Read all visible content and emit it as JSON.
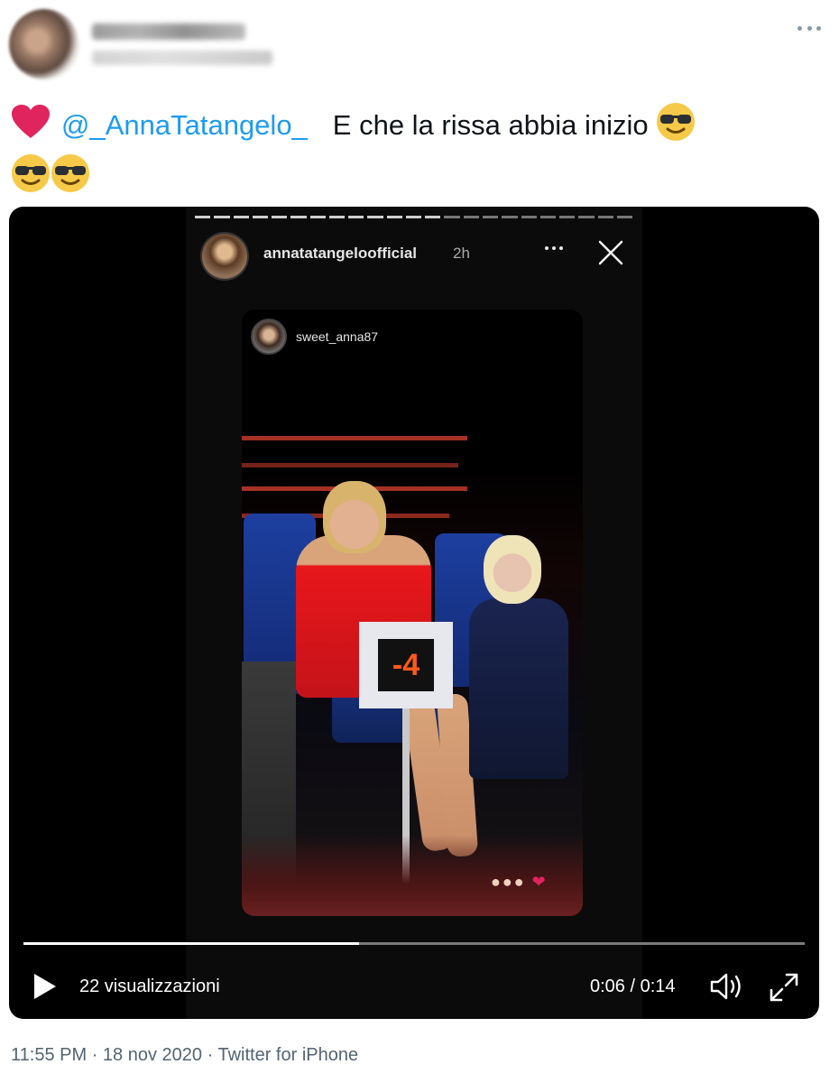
{
  "tweet": {
    "text_parts": {
      "heart_emoji": "❤️",
      "mention": "@_AnnaTatangelo_",
      "message": "E che la rissa abbia inizio",
      "emoji": "😎"
    }
  },
  "story": {
    "username": "annatatangeloofficial",
    "time_ago": "2h",
    "reposted_username": "sweet_anna87",
    "scene_number": "-4",
    "progress_segments_total": 23,
    "progress_segments_done": 13
  },
  "video": {
    "views_label": "22 visualizzazioni",
    "time_label": "0:06 / 0:14",
    "playback_fraction": 0.43
  },
  "footer": {
    "time": "11:55 PM",
    "date": "18 nov 2020",
    "separator": "·",
    "source": "Twitter for iPhone"
  }
}
